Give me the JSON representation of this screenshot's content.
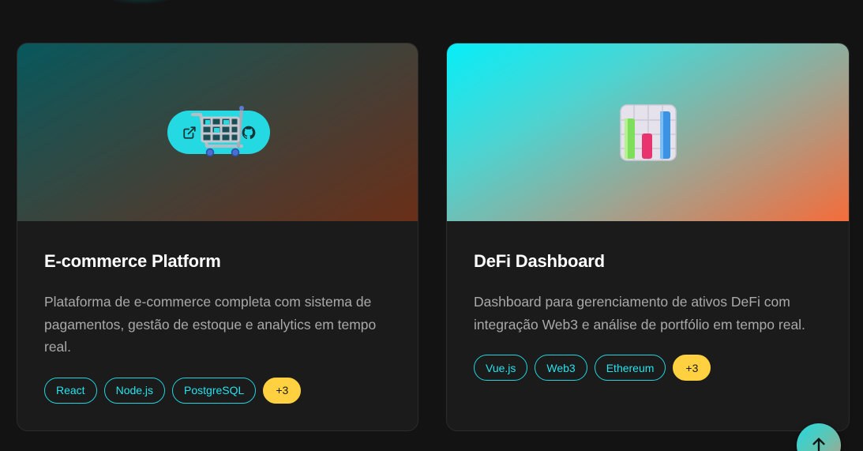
{
  "projects": [
    {
      "title": "E-commerce Platform",
      "description": "Plataforma de e-commerce completa com sistema de pagamentos, gestão de estoque e analytics em tempo real.",
      "icon": "shopping-cart-icon",
      "tags": [
        "React",
        "Node.js",
        "PostgreSQL"
      ],
      "more": "+3",
      "gradient": [
        "#07585d",
        "#6a2f17"
      ]
    },
    {
      "title": "DeFi Dashboard",
      "description": "Dashboard para gerenciamento de ativos DeFi com integração Web3 e análise de portfólio em tempo real.",
      "icon": "bar-chart-icon",
      "tags": [
        "Vue.js",
        "Web3",
        "Ethereum"
      ],
      "more": "+3",
      "gradient": [
        "#06eef8",
        "#f56c3a"
      ]
    }
  ],
  "colors": {
    "accent": "#25e3ee",
    "more_badge": "#ffd03f",
    "background": "#131313",
    "card": "#1b1b1b"
  },
  "scroll_top": {
    "icon": "arrow-up-icon"
  }
}
